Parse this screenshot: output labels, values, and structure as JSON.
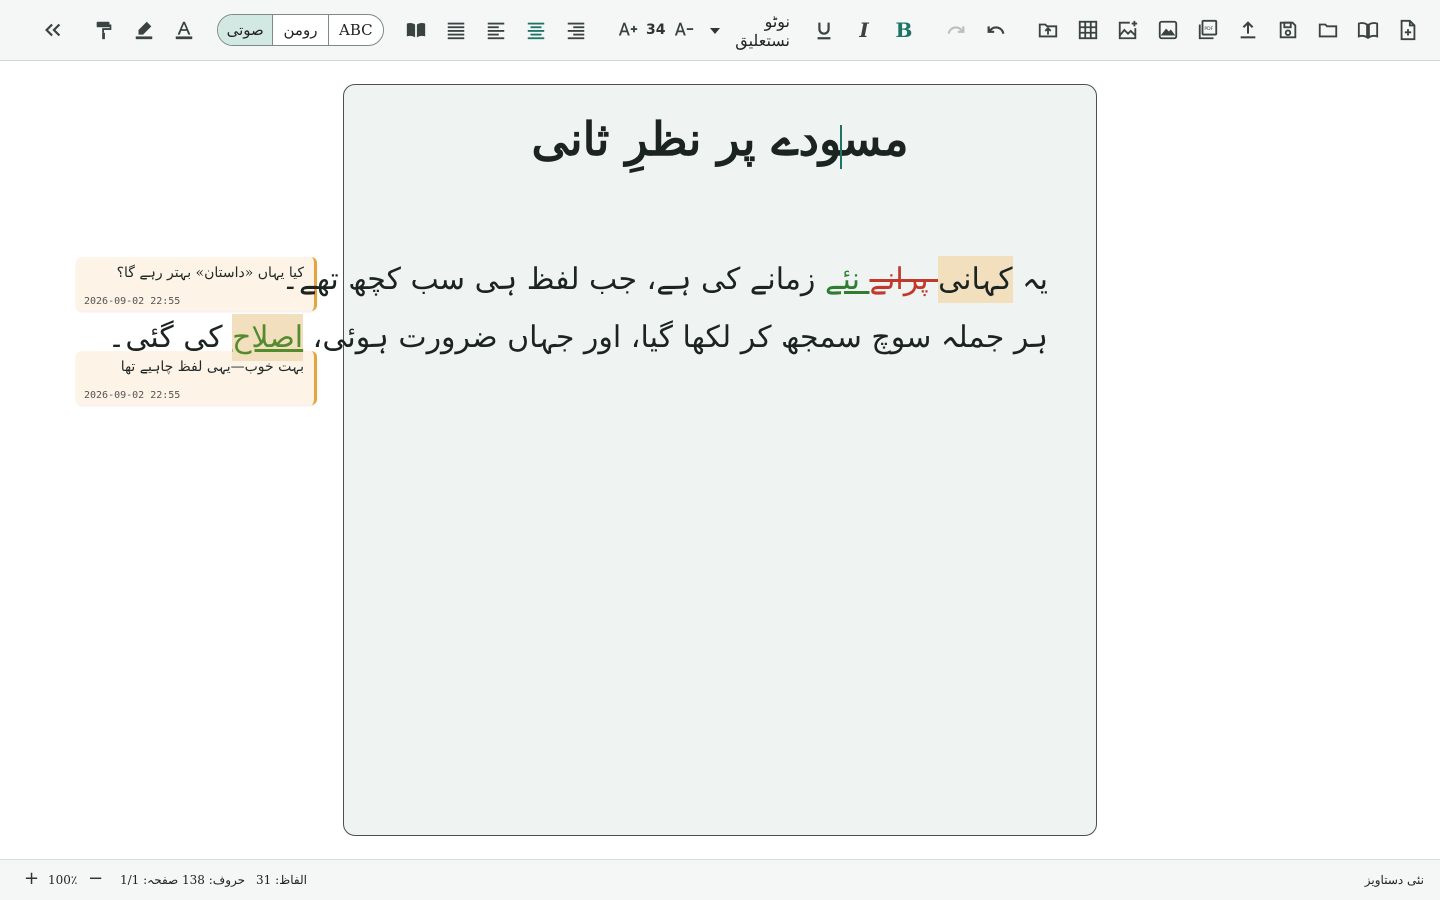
{
  "toolbar": {
    "keyboard_modes": [
      "صوتی",
      "رومن",
      "ABC"
    ],
    "selected_keyboard": "صوتی",
    "font_size": "34",
    "font_name": "نوٹو نستعلیق",
    "bold_label": "B",
    "italic_label": "I"
  },
  "document": {
    "title": "مسودے پر نظرِ ثانی",
    "line1": {
      "pre": "یہ ",
      "highlight": "کہانی",
      "deleted": " پرانے",
      "inserted": " نئے",
      "post": " زمانے کی ہے، جب لفظ ہی سب کچھ تھے۔"
    },
    "line2": {
      "pre": "ہر جملہ سوچ سمجھ کر لکھا گیا، اور جہاں ضرورت ہوئی، ",
      "highlight": "اصلاح",
      "post": " کی گئی۔"
    }
  },
  "comments": [
    {
      "text": "کیا یہاں «داستان» بہتر رہے گا؟",
      "time": "2026-09-02 22:55"
    },
    {
      "text": "بہت خوب—یہی لفظ چاہیے تھا",
      "time": "2026-09-02 22:55"
    }
  ],
  "status": {
    "zoom": "100٪",
    "page": "صفحہ: 1/1",
    "chars": "حروف: 138",
    "words": "الفاظ: 31",
    "doc_name": "نئی دستاویز"
  },
  "colors": {
    "accent": "#1e7466",
    "deleted": "#c0392b",
    "inserted": "#2e7d32",
    "comment_border": "#e5a43d",
    "highlight": "#f1dfbd"
  }
}
